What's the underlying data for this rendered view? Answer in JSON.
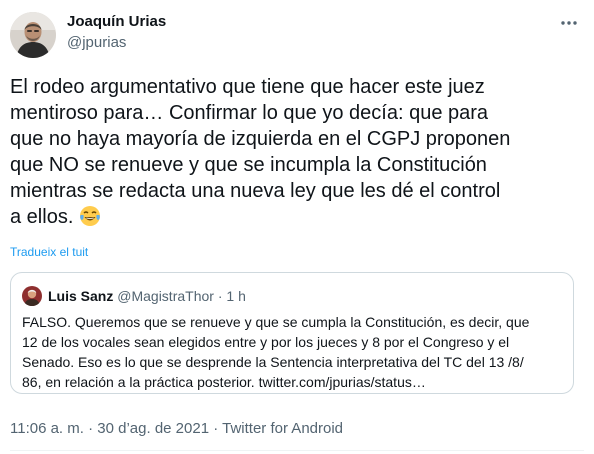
{
  "author": {
    "display_name": "Joaquín Urias",
    "handle": "@jpurias"
  },
  "more_icon": "more-icon",
  "tweet": {
    "text": "El rodeo argumentativo que tiene que hacer este juez\nmentiroso para… Confirmar lo que yo decía: que para\nque no haya mayoría de izquierda en el CGPJ proponen\nque NO se renueve y que se incumpla la Constitución\nmientras se redacta una nueva ley que les dé el control\na ellos. ",
    "emoji": "face-with-tears-of-joy"
  },
  "translate_label": "Tradueix el tuit",
  "quote": {
    "display_name": "Luis Sanz",
    "handle": "@MagistraThor",
    "separator": " · ",
    "time_ago": "1 h",
    "text": "FALSO. Queremos que se renueve y que se cumpla la Constitución, es decir, que\n12 de los vocales sean elegidos entre y por los jueces y 8 por el Congreso y el\nSenado. Eso es lo que se desprende la Sentencia interpretativa del TC del 13 /8/\n86, en relación a la práctica posterior. twitter.com/jpurias/status…"
  },
  "footer": {
    "time": "11:06 a. m.",
    "separator": " · ",
    "date": "30 d’ag. de 2021",
    "separator2": " · ",
    "source": "Twitter for Android"
  },
  "colors": {
    "text": "#0f1419",
    "secondary": "#536471",
    "link": "#1d9bf0",
    "border": "#cfd9de"
  }
}
